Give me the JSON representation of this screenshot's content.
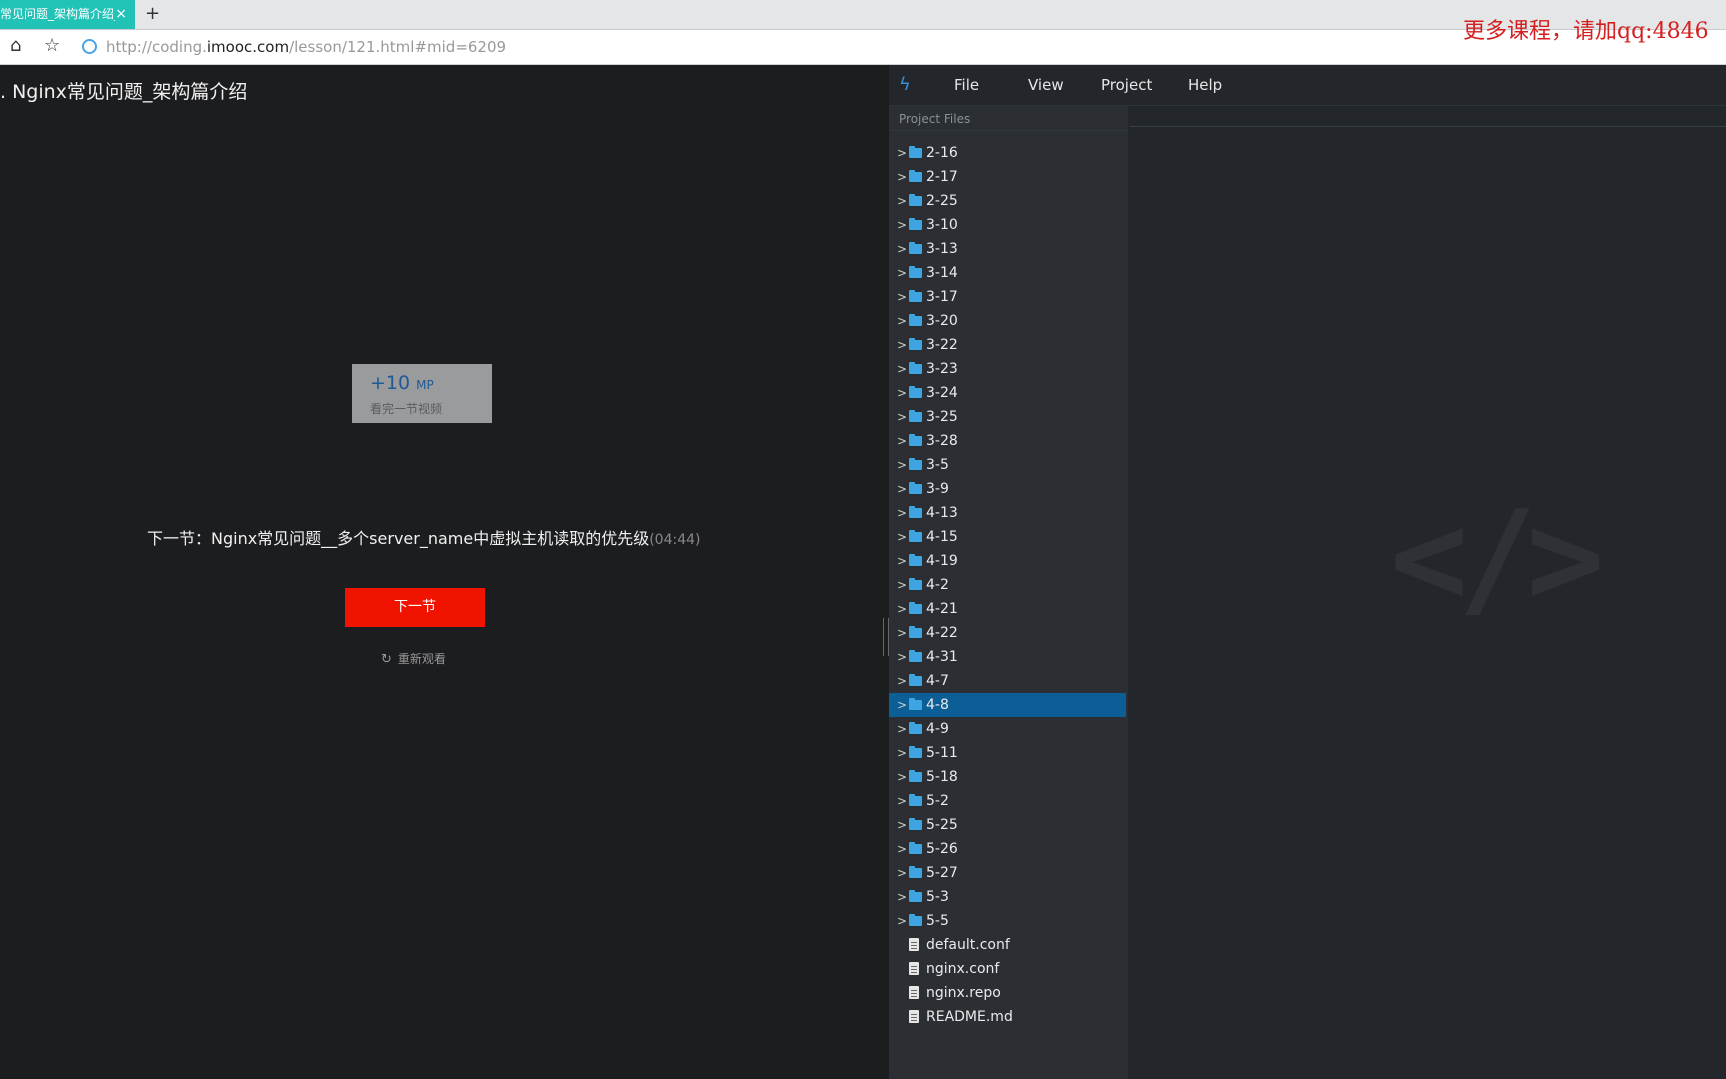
{
  "browser": {
    "tab_title": "常见问题_架构篇介绍_",
    "tab_close": "×",
    "new_tab": "+",
    "url_prefix": "http://coding.",
    "url_host": "imooc.com",
    "url_path": "/lesson/121.html#mid=6209",
    "promo_text": "更多课程，请加qq:4846"
  },
  "lesson": {
    "title": ". Nginx常见问题_架构篇介绍",
    "mp_value": "+10",
    "mp_unit": "MP",
    "mp_caption": "看完一节视频",
    "next_info": "下一节：Nginx常见问题__多个server_name中虚拟主机读取的优先级",
    "next_duration": "(04:44)",
    "next_button": "下一节",
    "replay": "重新观看"
  },
  "editor": {
    "menu": [
      "File",
      "View",
      "Project",
      "Help"
    ],
    "sidebar_header": "Project Files",
    "folders": [
      "2-16",
      "2-17",
      "2-25",
      "3-10",
      "3-13",
      "3-14",
      "3-17",
      "3-20",
      "3-22",
      "3-23",
      "3-24",
      "3-25",
      "3-28",
      "3-5",
      "3-9",
      "4-13",
      "4-15",
      "4-19",
      "4-2",
      "4-21",
      "4-22",
      "4-31",
      "4-7",
      "4-8",
      "4-9",
      "5-11",
      "5-18",
      "5-2",
      "5-25",
      "5-26",
      "5-27",
      "5-3",
      "5-5"
    ],
    "selected_folder": "4-8",
    "files": [
      "default.conf",
      "nginx.conf",
      "nginx.repo",
      "README.md"
    ],
    "placeholder_glyph": "</>"
  },
  "colors": {
    "tab_accent": "#22c3b7",
    "next_button": "#f01400",
    "selected_row": "#0b5e96",
    "folder": "#3ea4e2",
    "promo": "#d51f1f"
  }
}
